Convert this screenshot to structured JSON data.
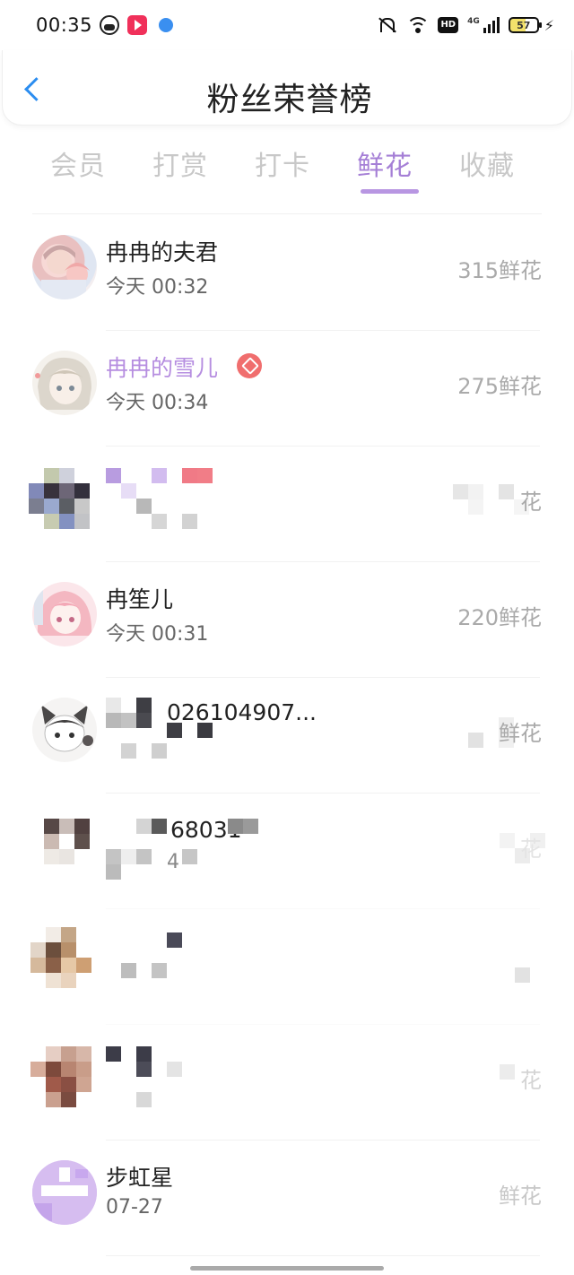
{
  "status_bar": {
    "time": "00:35",
    "battery_level": "57",
    "network": "4G",
    "hd_label": "HD",
    "icons": [
      "app-panda-icon",
      "video-app-icon",
      "bird-app-icon",
      "mute-icon",
      "wifi-icon",
      "hd-icon",
      "signal-icon",
      "battery-icon",
      "charging-icon"
    ]
  },
  "header": {
    "title": "粉丝荣誉榜",
    "back_icon": "chevron-left-icon"
  },
  "tabs": [
    {
      "label": "会员",
      "active": false
    },
    {
      "label": "打赏",
      "active": false
    },
    {
      "label": "打卡",
      "active": false
    },
    {
      "label": "鲜花",
      "active": true
    },
    {
      "label": "收藏",
      "active": false
    }
  ],
  "colors": {
    "accent": "#a57fd6",
    "back": "#2b8df0",
    "vip_name": "#b68ee0",
    "badge": "#f06e6e"
  },
  "list": [
    {
      "name": "冉冉的夫君",
      "time": "今天 00:32",
      "count": "315鲜花",
      "vip": false
    },
    {
      "name": "冉冉的雪儿",
      "time": "今天 00:34",
      "count": "275鲜花",
      "vip": true
    },
    {
      "name": "",
      "time": "",
      "count": "花",
      "vip": false
    },
    {
      "name": "冉笙儿",
      "time": "今天 00:31",
      "count": "220鲜花",
      "vip": false
    },
    {
      "name": "026104907...",
      "time": "",
      "count": "鲜花",
      "vip": false
    },
    {
      "name": "68031",
      "time": "4",
      "count": "花",
      "vip": false
    },
    {
      "name": "",
      "time": "",
      "count": "",
      "vip": false
    },
    {
      "name": "",
      "time": "",
      "count": "花",
      "vip": false
    },
    {
      "name": "步虹星",
      "time": "07-27",
      "count": "鲜花",
      "vip": false
    }
  ]
}
